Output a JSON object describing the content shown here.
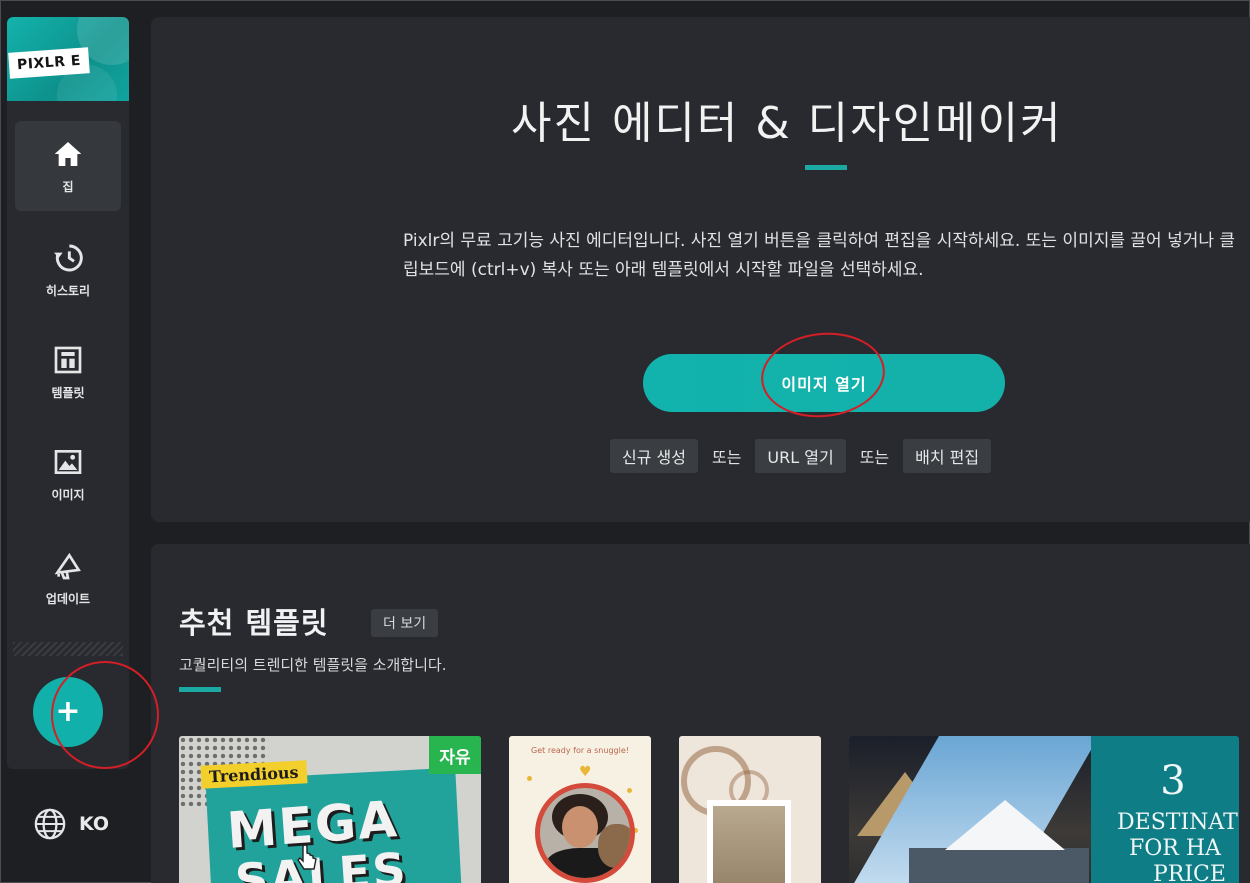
{
  "logo": {
    "text": "PIXLR E"
  },
  "sidebar": {
    "items": [
      {
        "label": "집",
        "icon": "home-icon"
      },
      {
        "label": "히스토리",
        "icon": "history-icon"
      },
      {
        "label": "템플릿",
        "icon": "template-icon"
      },
      {
        "label": "이미지",
        "icon": "image-icon"
      },
      {
        "label": "업데이트",
        "icon": "megaphone-icon"
      }
    ],
    "create_symbol": "+",
    "language": "KO"
  },
  "hero": {
    "title": "사진 에디터 & 디자인메이커",
    "description": "Pixlr의 무료 고기능 사진 에디터입니다. 사진 열기 버튼을 클릭하여 편집을 시작하세요. 또는 이미지를 끌어 넣거나 클립보드에 (ctrl+v) 복사 또는 아래 템플릿에서 시작할 파일을 선택하세요.",
    "open_button": "이미지 열기",
    "links": [
      "신규 생성",
      "URL 열기",
      "배치 편집"
    ],
    "or_text": "또는"
  },
  "templates": {
    "title": "추천 템플릿",
    "more": "더 보기",
    "subtitle": "고퀄리티의 트렌디한 템플릿을 소개합니다.",
    "cards": [
      {
        "line1": "Trendious",
        "line2": "MEGA",
        "line3": "SALES",
        "badge": "자유"
      },
      {
        "caption": "Get ready for a snuggle!"
      },
      {},
      {
        "number": "3",
        "line1": "DESTINATI",
        "line2": "FOR HA",
        "line3": "PRICE"
      }
    ]
  },
  "colors": {
    "accent": "#11b0aa",
    "annotation": "#d31f27",
    "panel": "#282a2f",
    "background": "#1d1f23"
  }
}
